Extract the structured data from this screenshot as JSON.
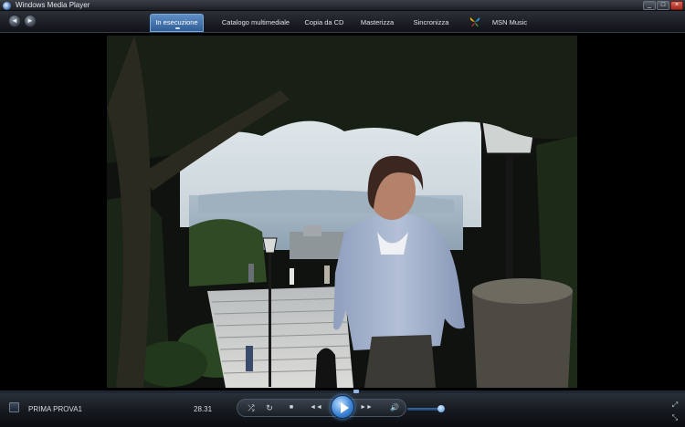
{
  "window": {
    "title": "Windows Media Player",
    "controls": {
      "minimize": "_",
      "maximize": "□",
      "close": "×"
    }
  },
  "nav": {
    "back_icon": "◄",
    "forward_icon": "►",
    "tabs": [
      {
        "label": "In esecuzione",
        "active": true
      },
      {
        "label": "Catalogo multimediale",
        "active": false
      },
      {
        "label": "Copia da CD",
        "active": false
      },
      {
        "label": "Masterizza",
        "active": false
      },
      {
        "label": "Sincronizza",
        "active": false
      },
      {
        "label": "MSN Music",
        "active": false
      }
    ]
  },
  "player": {
    "now_playing": "PRIMA PROVA1",
    "elapsed_time": "28.31",
    "volume_level": 0.85,
    "seek_position": 0.52
  },
  "controls": {
    "shuffle_icon": "⤮",
    "repeat_icon": "↻",
    "stop_icon": "■",
    "previous_icon": "◄◄",
    "next_icon": "►►",
    "mute_icon": "🔊",
    "fullscreen_icon": "⤢",
    "compact_icon": "⤡"
  },
  "colors": {
    "accent": "#3f86d6",
    "active_tab": "#4a7fbf",
    "chrome_dark": "#14181e"
  }
}
